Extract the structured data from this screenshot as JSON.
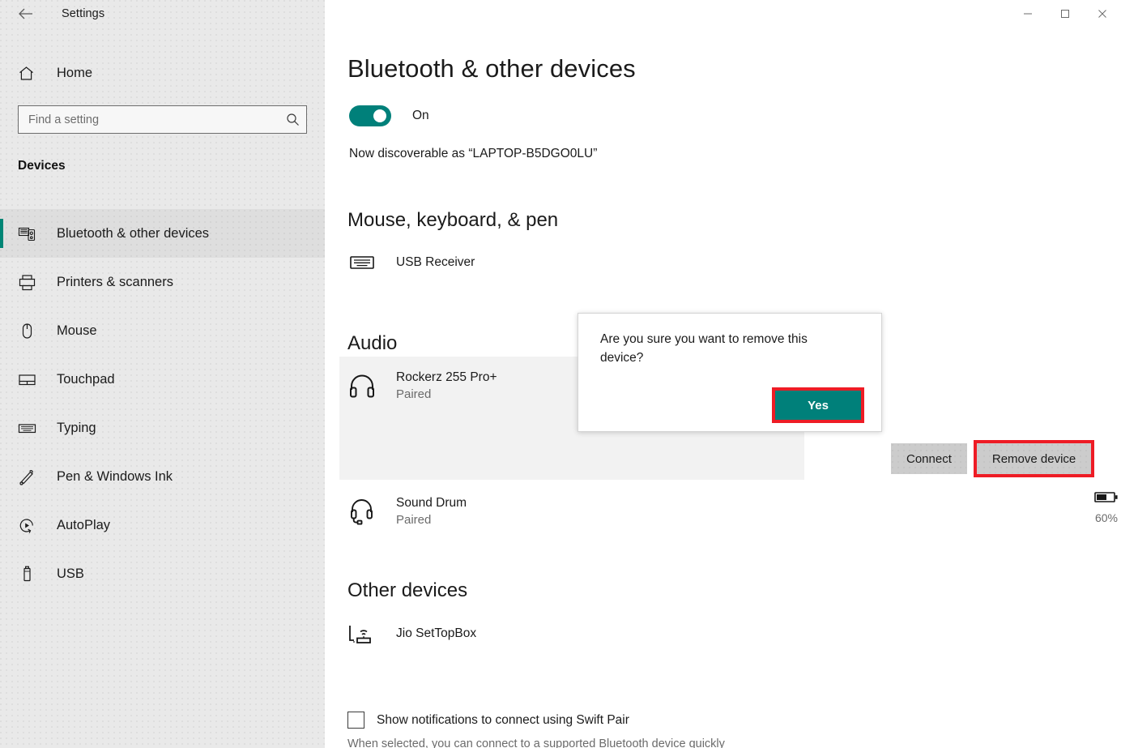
{
  "window": {
    "title": "Settings",
    "back_icon": "back-arrow-icon",
    "minimize_label": "─",
    "maximize_label": "☐",
    "close_label": "✕"
  },
  "sidebar": {
    "home_label": "Home",
    "home_icon": "home-icon",
    "search": {
      "placeholder": "Find a setting",
      "value": "",
      "icon": "search-icon"
    },
    "category_heading": "Devices",
    "items": [
      {
        "label": "Bluetooth & other devices",
        "icon": "bluetooth-devices-icon",
        "selected": true
      },
      {
        "label": "Printers & scanners",
        "icon": "printer-icon",
        "selected": false
      },
      {
        "label": "Mouse",
        "icon": "mouse-icon",
        "selected": false
      },
      {
        "label": "Touchpad",
        "icon": "touchpad-icon",
        "selected": false
      },
      {
        "label": "Typing",
        "icon": "keyboard-icon",
        "selected": false
      },
      {
        "label": "Pen & Windows Ink",
        "icon": "pen-icon",
        "selected": false
      },
      {
        "label": "AutoPlay",
        "icon": "autoplay-icon",
        "selected": false
      },
      {
        "label": "USB",
        "icon": "usb-drive-icon",
        "selected": false
      }
    ]
  },
  "main": {
    "page_title": "Bluetooth & other devices",
    "bluetooth_toggle": {
      "state_label": "On",
      "on": true
    },
    "discoverable_text": "Now discoverable as “LAPTOP-B5DGO0LU”",
    "groups": [
      {
        "title": "Mouse, keyboard, & pen",
        "devices": [
          {
            "name": "USB Receiver",
            "status": "",
            "icon": "keyboard-device-icon"
          }
        ]
      },
      {
        "title": "Audio",
        "devices": [
          {
            "name": "Rockerz 255 Pro+",
            "status": "Paired",
            "icon": "headphones-icon",
            "selected": true
          },
          {
            "name": "Sound Drum",
            "status": "Paired",
            "icon": "headset-icon",
            "battery": "60%"
          }
        ]
      },
      {
        "title": "Other devices",
        "devices": [
          {
            "name": "Jio SetTopBox",
            "status": "",
            "icon": "settopbox-icon"
          }
        ]
      }
    ],
    "device_actions": {
      "connect_label": "Connect",
      "remove_label": "Remove device"
    },
    "swift_pair": {
      "label": "Show notifications to connect using Swift Pair",
      "checked": false,
      "description_cut": "When selected, you can connect to a supported Bluetooth device quickly"
    }
  },
  "dialog": {
    "message": "Are you sure you want to remove this device?",
    "confirm_label": "Yes"
  },
  "colors": {
    "accent_teal": "#00807A",
    "annotation_red": "#ee1c25",
    "sidebar_bg": "#e9e9e9",
    "selected_row_bg": "#f2f2f2",
    "button_gray": "#cccccc"
  }
}
